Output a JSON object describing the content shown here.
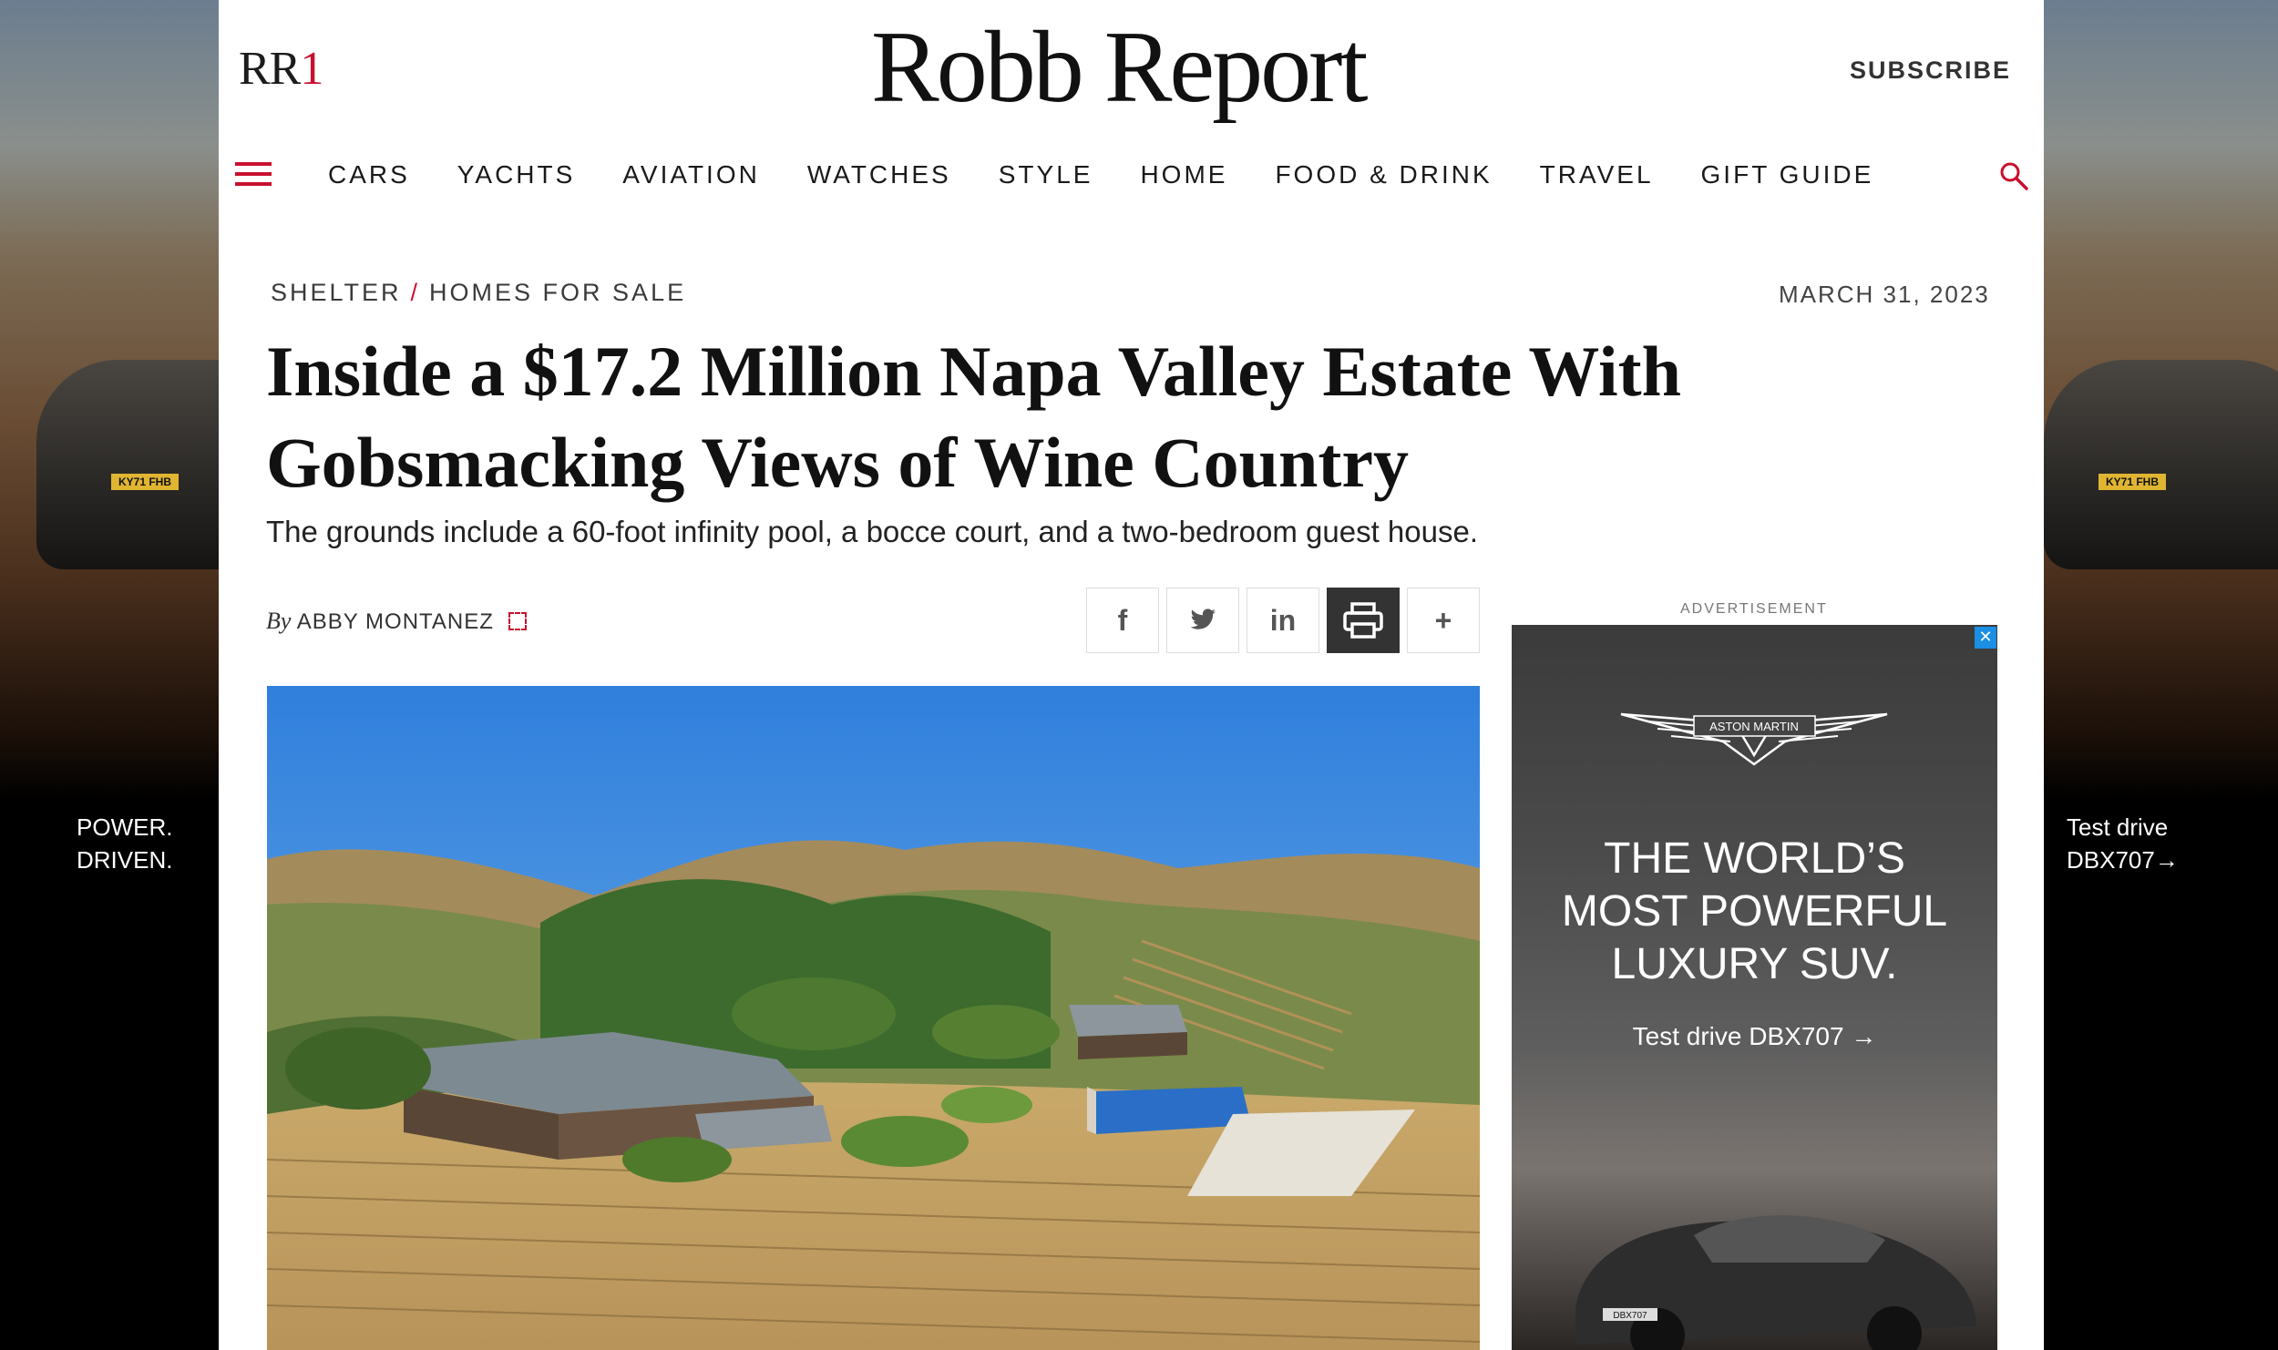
{
  "side_ad": {
    "left_tagline": [
      "POWER.",
      "DRIVEN."
    ],
    "right_tagline": [
      "Test drive",
      "DBX707→"
    ],
    "plate": "KY71 FHB"
  },
  "header": {
    "brand_mark": "RR",
    "brand_mark_digit": "1",
    "logo": "Robb Report",
    "subscribe": "SUBSCRIBE"
  },
  "nav": {
    "items": [
      "CARS",
      "YACHTS",
      "AVIATION",
      "WATCHES",
      "STYLE",
      "HOME",
      "FOOD & DRINK",
      "TRAVEL",
      "GIFT GUIDE"
    ]
  },
  "article": {
    "breadcrumb": [
      "SHELTER",
      "HOMES FOR SALE"
    ],
    "breadcrumb_sep": "/",
    "date": "MARCH 31, 2023",
    "headline": "Inside a $17.2 Million Napa Valley Estate With Gobsmacking Views of Wine Country",
    "dek": "The grounds include a 60-foot infinity pool, a bocce court, and a two-bedroom guest house.",
    "by": "By",
    "author": "ABBY MONTANEZ"
  },
  "share": {
    "facebook": "f",
    "linkedin": "in",
    "more": "+"
  },
  "ad": {
    "label": "ADVERTISEMENT",
    "close": "✕",
    "brand": "ASTON MARTIN",
    "headline": [
      "THE WORLD’S",
      "MOST POWERFUL",
      "LUXURY SUV."
    ],
    "cta": "Test drive DBX707 →",
    "car_plate": "DBX707"
  },
  "colors": {
    "accent": "#c8102e",
    "sky": "#3d8de0",
    "ad_close": "#1a8fe3"
  }
}
